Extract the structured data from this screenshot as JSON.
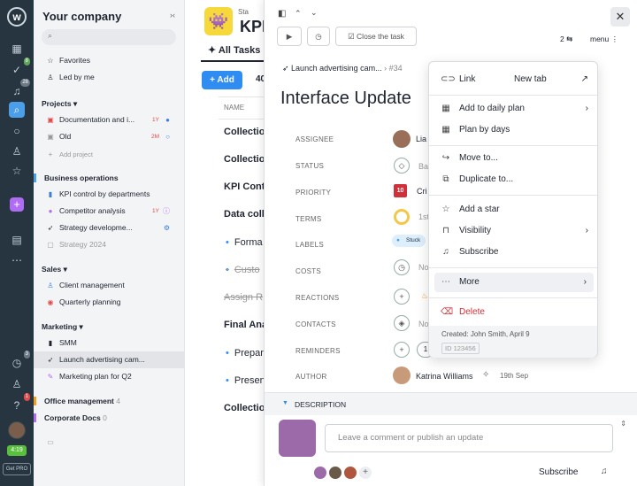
{
  "rail": {
    "logo": "w",
    "badges": {
      "mentions": "8",
      "notif": "28",
      "timer": "3",
      "alerts": "1"
    },
    "timer_text": "4:19",
    "pro_label": "Get PRO",
    "accent": "#4a9fe8"
  },
  "sidebar": {
    "company": "Your company",
    "favorites": "Favorites",
    "led_by_me": "Led by me",
    "projects_header": "Projects",
    "projects": [
      {
        "label": "Documentation and i...",
        "meta": "1Y"
      },
      {
        "label": "Old",
        "meta": "2M"
      }
    ],
    "add_project": "Add project",
    "biz_header": "Business operations",
    "biz": [
      {
        "label": "KPI control by departments"
      },
      {
        "label": "Competitor analysis",
        "meta": "1Y"
      },
      {
        "label": "Strategy developme..."
      },
      {
        "label": "Strategy 2024"
      }
    ],
    "sales_header": "Sales",
    "sales": [
      {
        "label": "Client management"
      },
      {
        "label": "Quarterly planning"
      }
    ],
    "marketing_header": "Marketing",
    "marketing": [
      {
        "label": "SMM"
      },
      {
        "label": "Launch advertising cam..."
      },
      {
        "label": "Marketing plan for Q2"
      }
    ],
    "office": "Office management",
    "office_count": "4",
    "corp": "Corporate Docs",
    "corp_count": "0"
  },
  "main": {
    "status_prefix": "Sta",
    "title": "KPI",
    "tab": "All Tasks",
    "add": "Add",
    "count": "40",
    "col_name": "NAME",
    "rows": [
      "Collection",
      "Collection",
      "KPI Cont",
      "Data coll",
      "Forma",
      "Custo",
      "Assign R",
      "Final Ana",
      "Prepar",
      "Presen",
      "Collection"
    ]
  },
  "task": {
    "close_task": "Close the task",
    "sub_count": "2",
    "menu_label": "menu",
    "breadcrumb": "Launch advertising cam...",
    "crumb_id": "#34",
    "title": "Interface Update",
    "fields": {
      "assignee": "ASSIGNEE",
      "status": "STATUS",
      "priority": "PRIORITY",
      "terms": "TERMS",
      "labels": "LABELS",
      "costs": "COSTS",
      "reactions": "REACTIONS",
      "contacts": "CONTACTS",
      "reminders": "REMINDERS",
      "author": "AUTHOR"
    },
    "assignee_name": "Lia",
    "status_val": "Ba",
    "priority_num": "10",
    "priority_val": "Cri",
    "terms_val": "1st",
    "label_chip": "Stuck",
    "costs_val": "No",
    "contacts_val": "No",
    "reminder_val": "1",
    "author_name": "Katrina Williams",
    "author_date": "19th Sep",
    "description": "DESCRIPTION",
    "comment_placeholder": "Leave a comment or publish an update",
    "subscribe": "Subscribe"
  },
  "context_menu": {
    "items": [
      {
        "label": "Link",
        "extra": "New tab"
      },
      {
        "label": "Add to daily plan"
      },
      {
        "label": "Plan by days"
      },
      {
        "label": "Move to..."
      },
      {
        "label": "Duplicate to..."
      },
      {
        "label": "Add a star"
      },
      {
        "label": "Visibility"
      },
      {
        "label": "Subscribe"
      },
      {
        "label": "More"
      },
      {
        "label": "Delete"
      }
    ],
    "created": "Created: John Smith, April 9",
    "id": "ID 123456"
  }
}
